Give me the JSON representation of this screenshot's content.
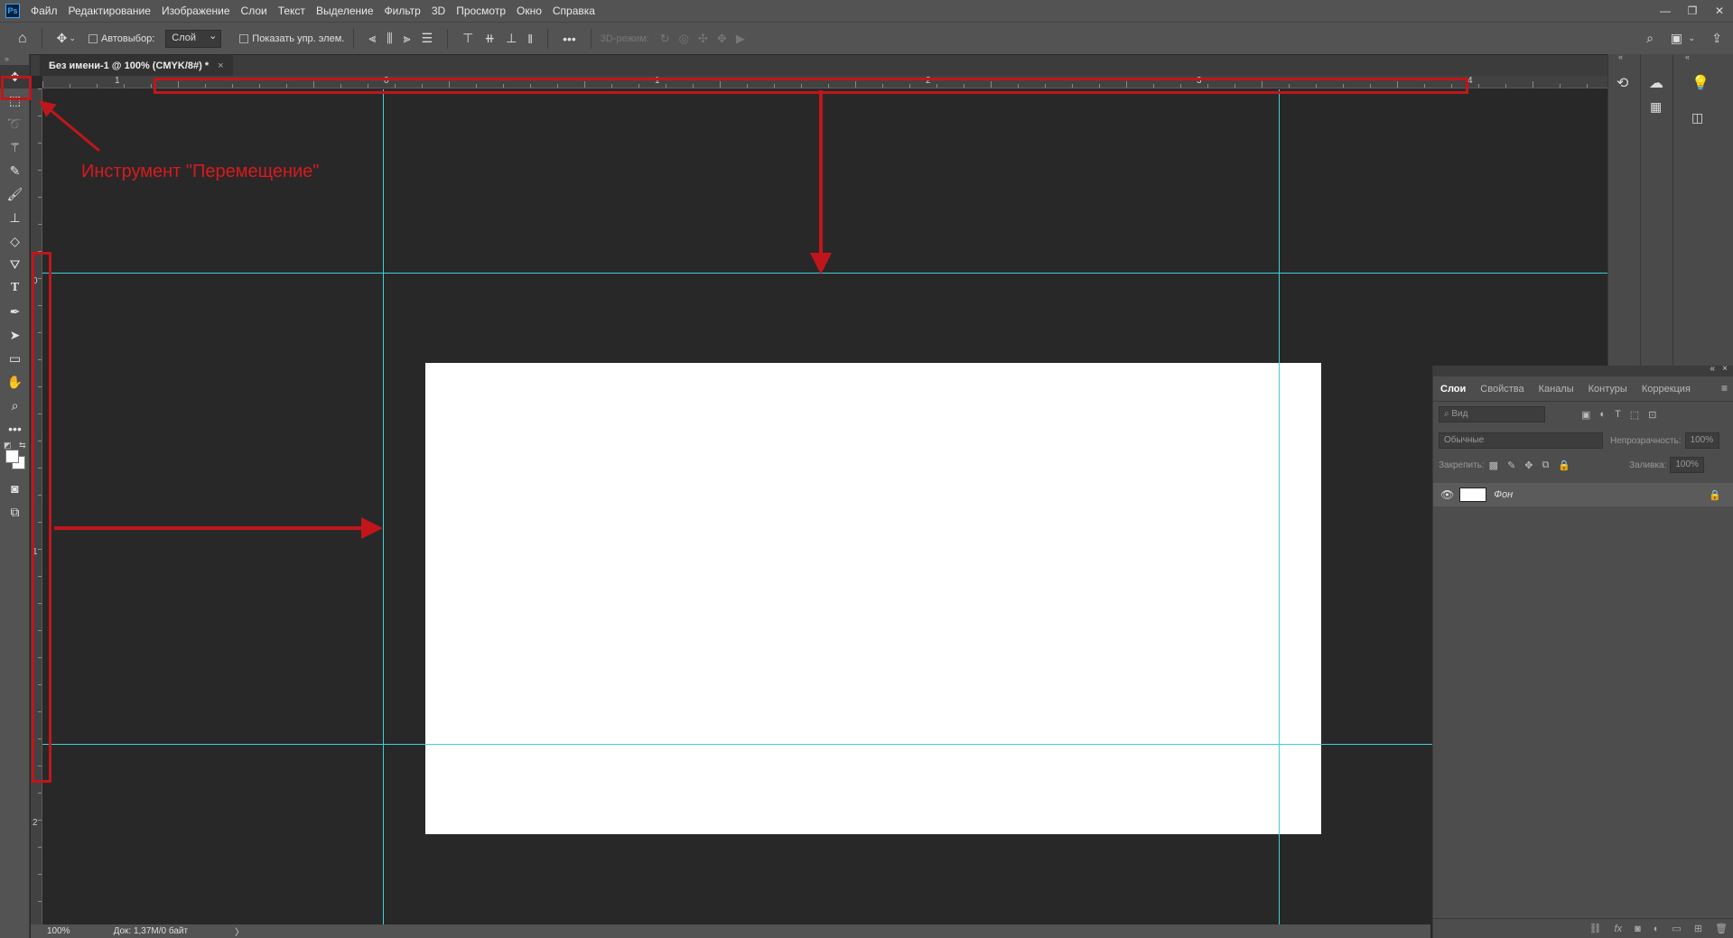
{
  "menu": {
    "logo": "Ps",
    "items": [
      "Файл",
      "Редактирование",
      "Изображение",
      "Слои",
      "Текст",
      "Выделение",
      "Фильтр",
      "3D",
      "Просмотр",
      "Окно",
      "Справка"
    ]
  },
  "options": {
    "autoselect_label": "Автовыбор:",
    "autoselect_value": "Слой",
    "show_transform_label": "Показать упр. элем.",
    "more": "•••",
    "mode3d_label": "3D-режим:"
  },
  "document": {
    "tab_title": "Без имени-1 @ 100% (CMYK/8#) *",
    "tab_close": "×"
  },
  "ruler": {
    "top_labels": [
      "1",
      "0",
      "1",
      "2",
      "3",
      "4"
    ],
    "left_labels": [
      "0",
      "1",
      "2"
    ]
  },
  "status": {
    "zoom": "100%",
    "doc_info": "Док: 1,37М/0 байт",
    "arrow": "〉"
  },
  "layers_panel": {
    "tabs": [
      "Слои",
      "Свойства",
      "Каналы",
      "Контуры",
      "Коррекция"
    ],
    "search_placeholder": "Вид",
    "blend_mode": "Обычные",
    "opacity_label": "Непрозрачность:",
    "opacity_value": "100%",
    "lock_label": "Закрепить:",
    "fill_label": "Заливка:",
    "fill_value": "100%",
    "layer_name": "Фон"
  },
  "annotation": {
    "move_tool_label": "Инструмент \"Перемещение\""
  },
  "colors": {
    "guide": "#3fd0d8",
    "annotation": "#c0161b",
    "canvas_bg": "#282828",
    "ui_bg": "#535353"
  }
}
